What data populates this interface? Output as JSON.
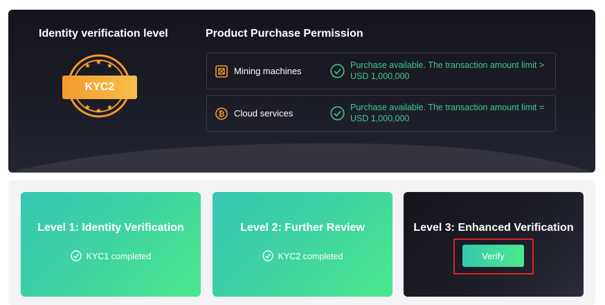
{
  "identity": {
    "title": "Identity verification level",
    "badge_label": "KYC2"
  },
  "permissions": {
    "title": "Product Purchase Permission",
    "items": [
      {
        "icon": "mining-machine-icon",
        "name": "Mining machines",
        "status": "Purchase available. The transaction amount limit > USD 1,000,000"
      },
      {
        "icon": "bitcoin-icon",
        "name": "Cloud services",
        "status": "Purchase available. The transaction amount limit = USD 1,000,000"
      }
    ]
  },
  "levels": [
    {
      "title": "Level 1: Identity Verification",
      "status": "KYC1 completed"
    },
    {
      "title": "Level 2: Further Review",
      "status": "KYC2 completed"
    },
    {
      "title": "Level 3: Enhanced Verification",
      "button_label": "Verify"
    }
  ],
  "colors": {
    "accent_green": "#3fc98a",
    "badge_orange": "#f49a2f",
    "highlight_red": "#d6262b"
  }
}
